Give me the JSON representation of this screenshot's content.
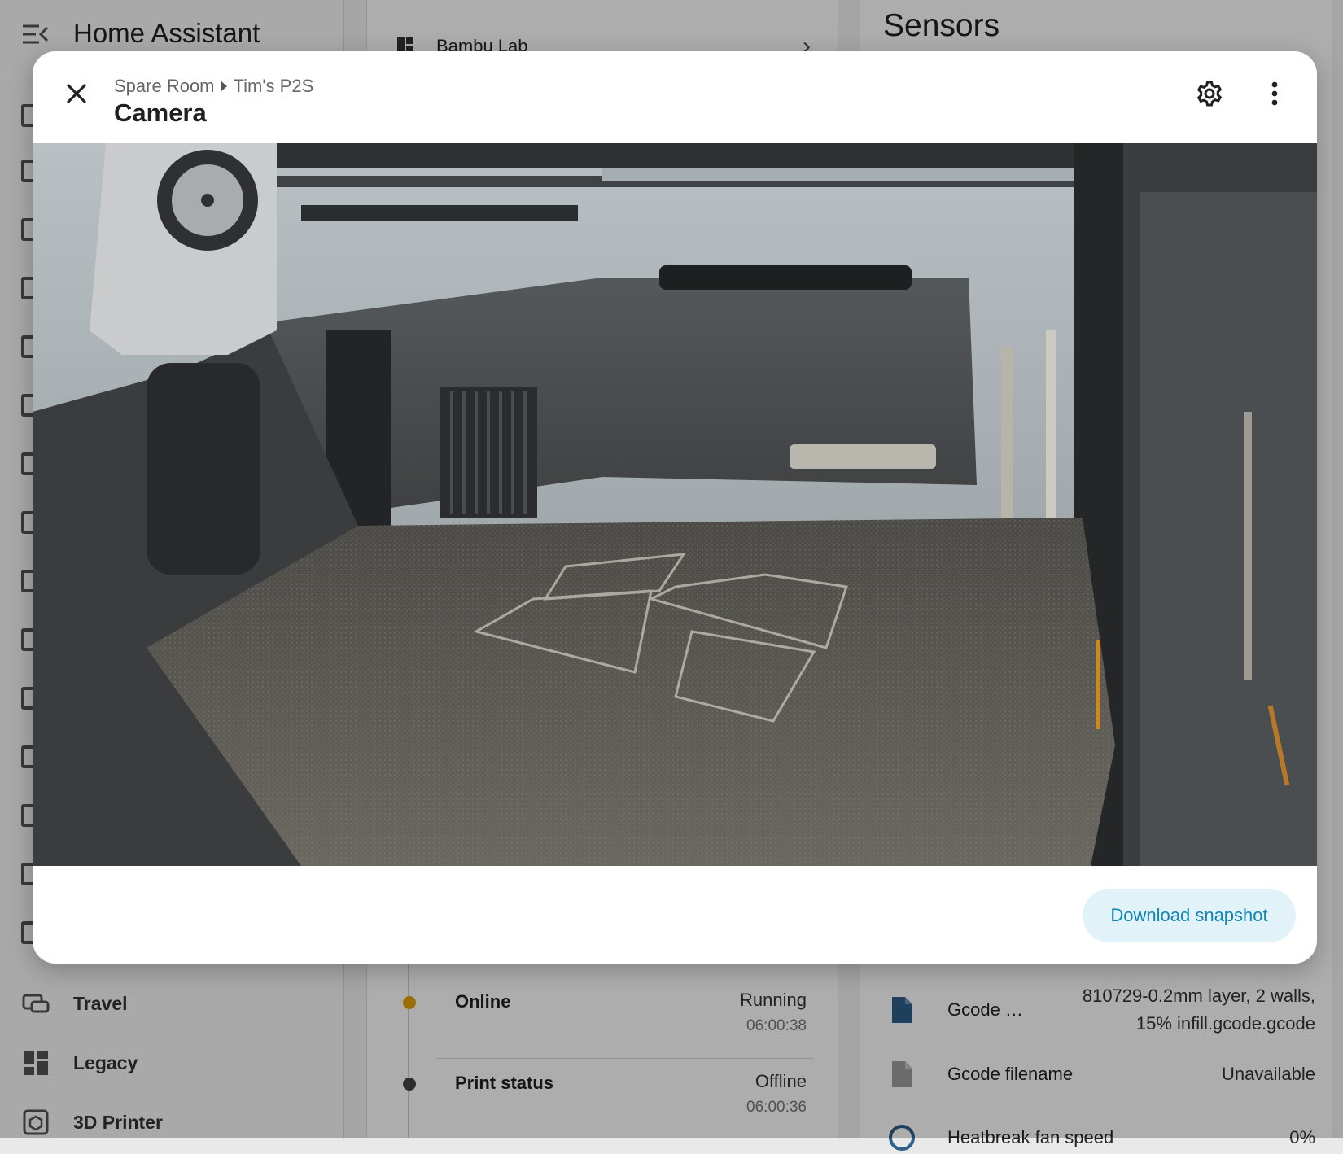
{
  "app": {
    "title": "Home Assistant"
  },
  "sidebar": {
    "items": [
      {
        "label": "Travel",
        "icon": "car-icon"
      },
      {
        "label": "Legacy",
        "icon": "dashboard-icon"
      },
      {
        "label": "3D Printer",
        "icon": "printer-3d-icon"
      }
    ]
  },
  "device_card": {
    "label": "Bambu Lab",
    "icon": "bambu-logo-icon"
  },
  "logbook": {
    "entries": [
      {
        "name": "Online",
        "state": "Running",
        "time": "06:00:38",
        "dot_color": "#e6a300"
      },
      {
        "name": "Print status",
        "state": "Offline",
        "time": "06:00:36",
        "dot_color": "#444444"
      }
    ]
  },
  "sensors": {
    "title": "Sensors",
    "rows": [
      {
        "name": "Gcode …",
        "value_line1": "810729-0.2mm layer, 2 walls,",
        "value_line2": "15% infill.gcode.gcode",
        "icon": "file-icon",
        "icon_color": "#2f5f8a"
      },
      {
        "name": "Gcode filename",
        "value": "Unavailable",
        "icon": "file-icon",
        "icon_color": "#9e9e9e"
      },
      {
        "name": "Heatbreak fan speed",
        "value": "0%",
        "icon": "fan-icon",
        "icon_color": "#2f5f8a"
      }
    ]
  },
  "dialog": {
    "breadcrumb": [
      "Spare Room",
      "Tim's P2S"
    ],
    "title": "Camera",
    "download_label": "Download snapshot",
    "accent": "#0f86b4"
  }
}
